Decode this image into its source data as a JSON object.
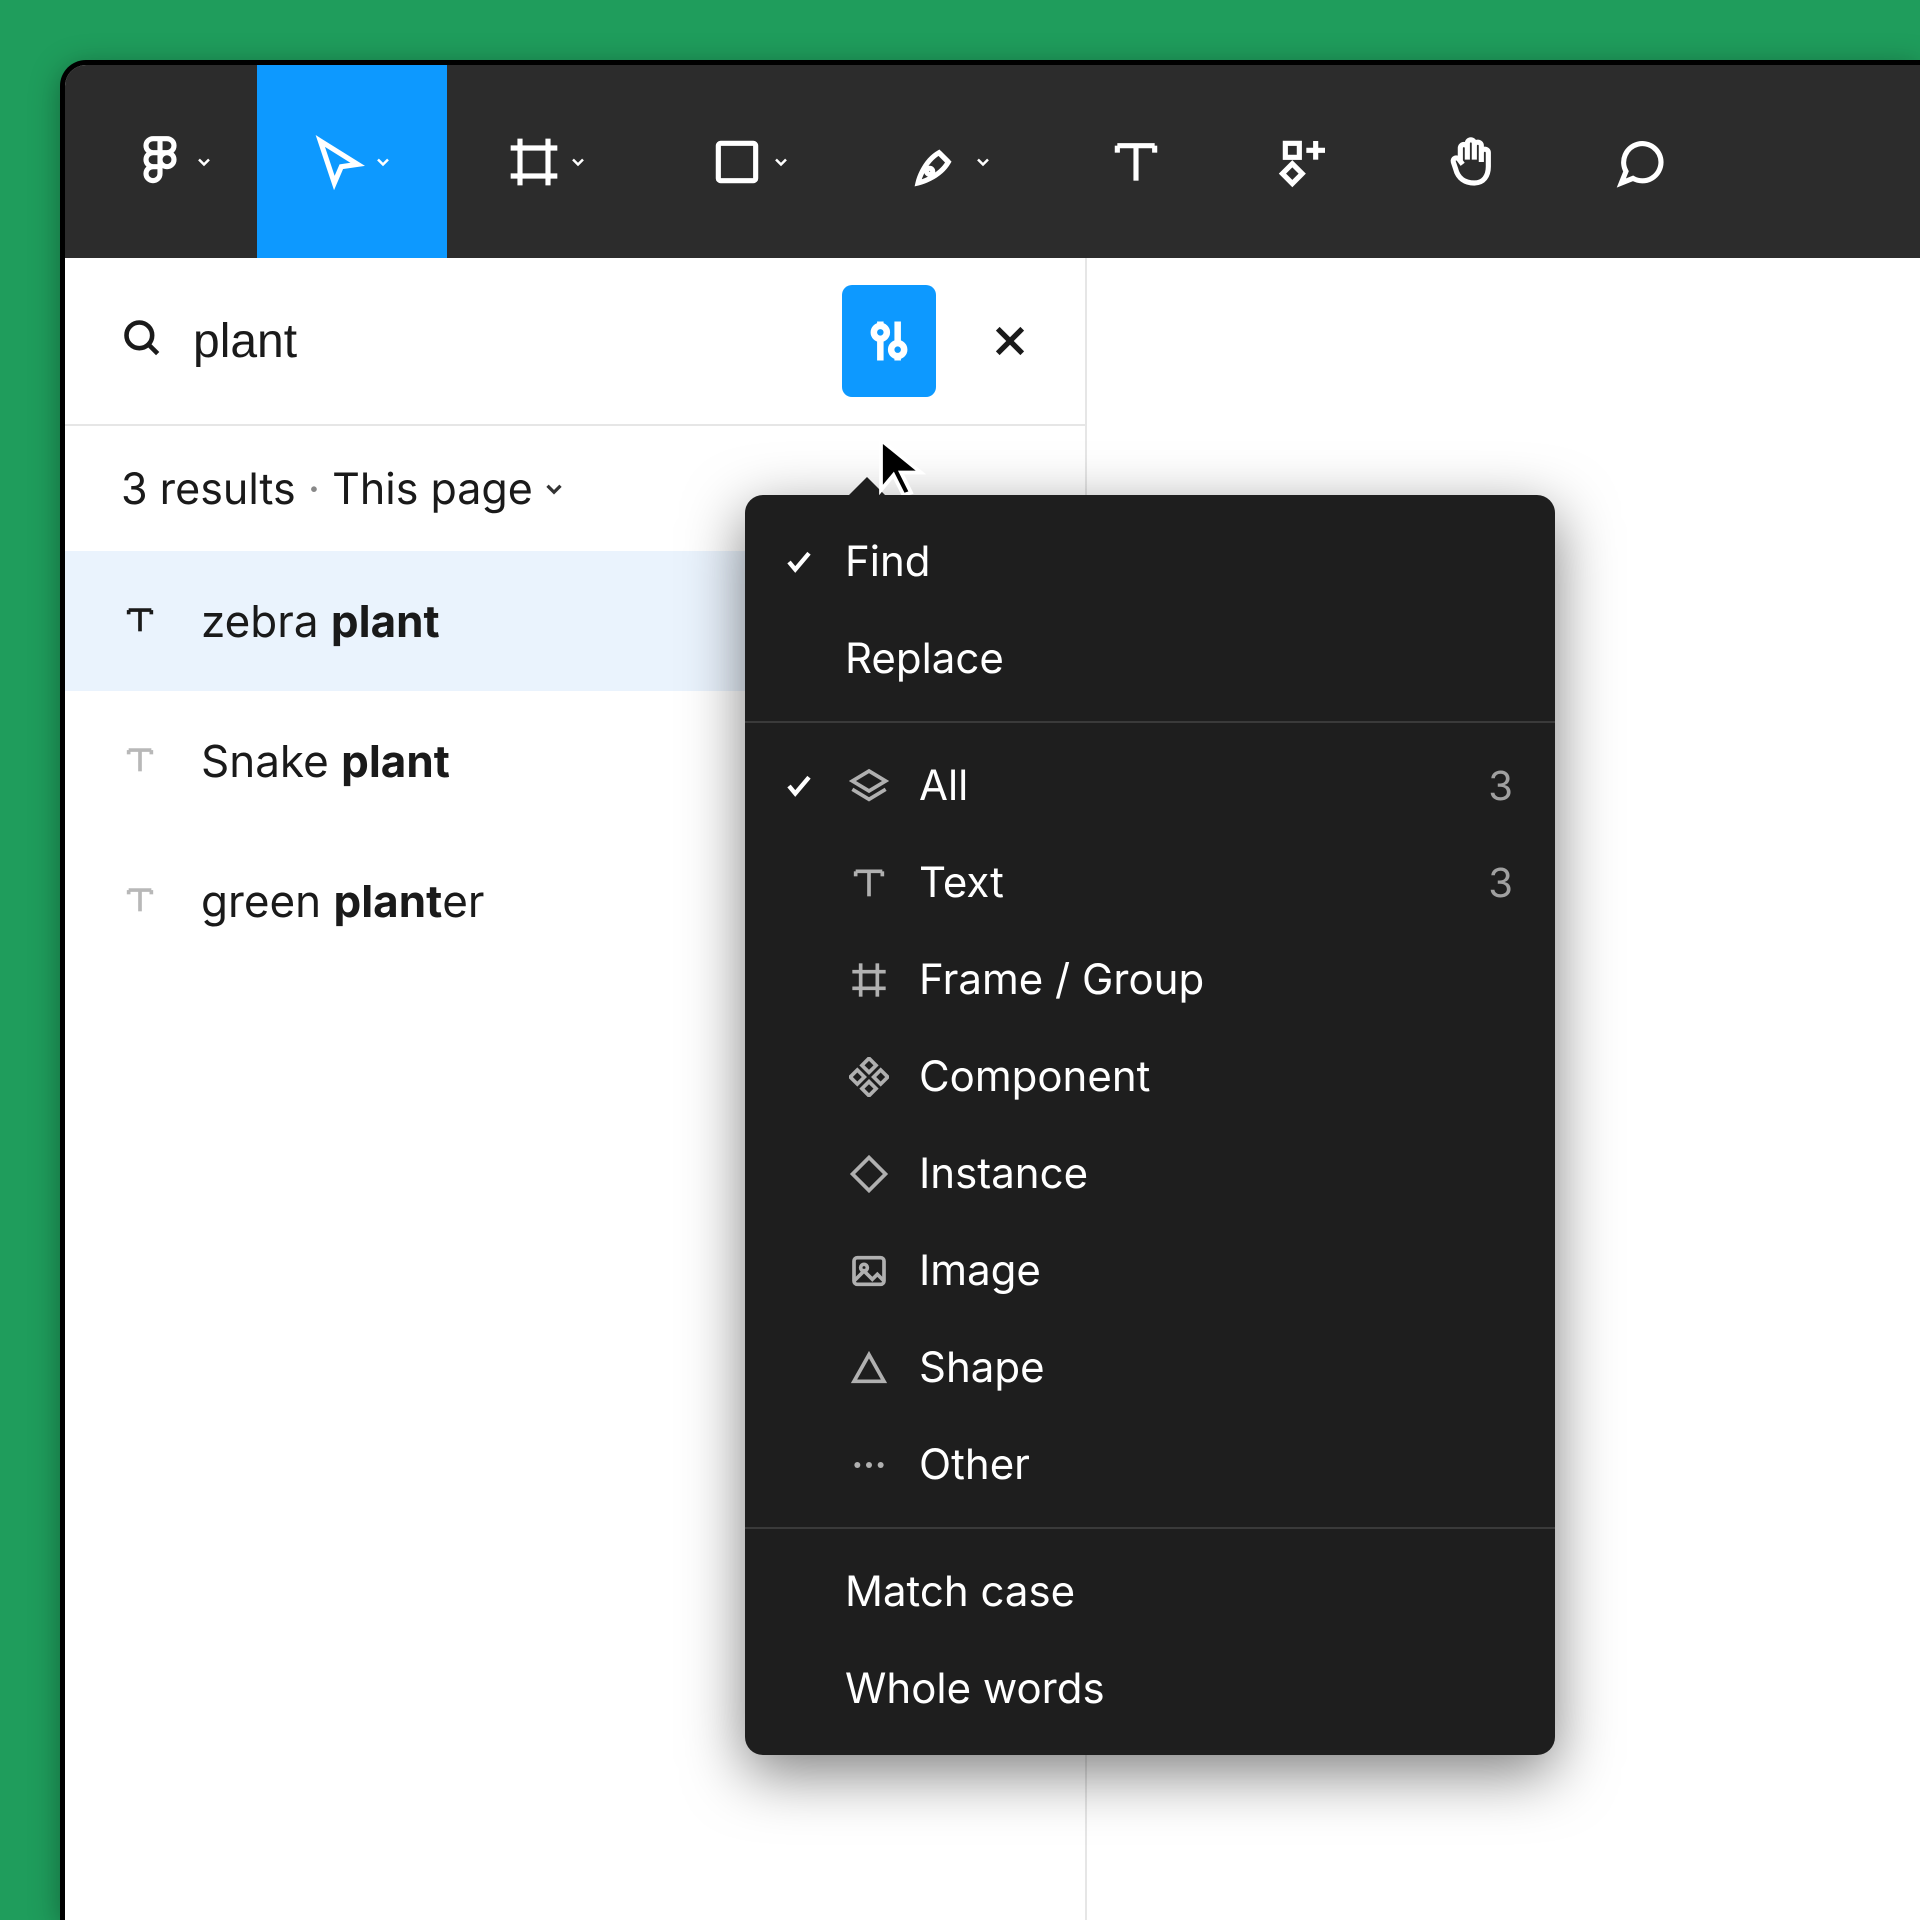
{
  "toolbar": {
    "tools": [
      "figma",
      "move",
      "frame",
      "shape",
      "pen",
      "text",
      "resources",
      "hand",
      "comment"
    ]
  },
  "search": {
    "query": "plant",
    "results_label": "3 results",
    "separator": "·",
    "scope": "This page",
    "items": [
      {
        "pre": "zebra ",
        "match": "plant",
        "post": "",
        "selected": true
      },
      {
        "pre": "Snake ",
        "match": "plant",
        "post": "",
        "selected": false
      },
      {
        "pre": "green ",
        "match": "plant",
        "post": "er",
        "selected": false
      }
    ]
  },
  "menu": {
    "mode": {
      "find": "Find",
      "replace": "Replace",
      "selected": "find"
    },
    "filters": [
      {
        "icon": "layers",
        "label": "All",
        "count": "3",
        "checked": true
      },
      {
        "icon": "text",
        "label": "Text",
        "count": "3",
        "checked": false
      },
      {
        "icon": "frame",
        "label": "Frame / Group",
        "count": "",
        "checked": false
      },
      {
        "icon": "component",
        "label": "Component",
        "count": "",
        "checked": false
      },
      {
        "icon": "instance",
        "label": "Instance",
        "count": "",
        "checked": false
      },
      {
        "icon": "image",
        "label": "Image",
        "count": "",
        "checked": false
      },
      {
        "icon": "shape",
        "label": "Shape",
        "count": "",
        "checked": false
      },
      {
        "icon": "other",
        "label": "Other",
        "count": "",
        "checked": false
      }
    ],
    "options": {
      "match_case": "Match case",
      "whole_words": "Whole words"
    }
  }
}
